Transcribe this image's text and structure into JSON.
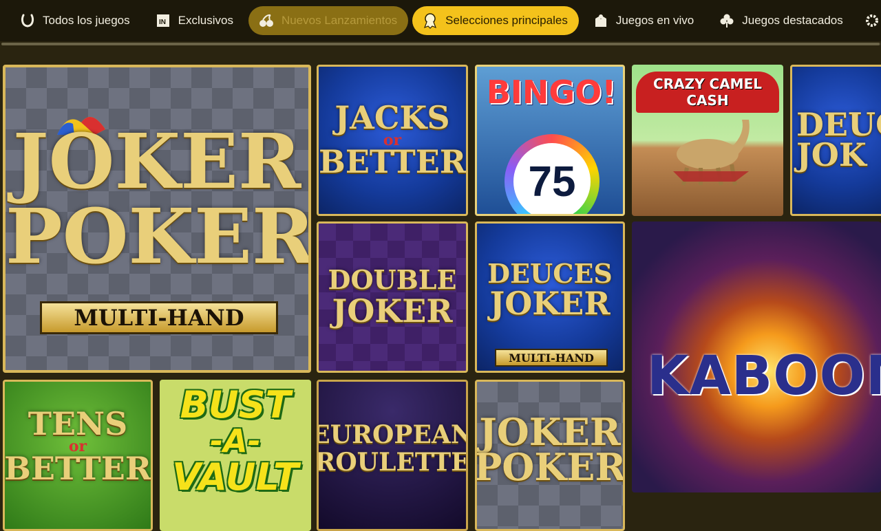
{
  "nav": {
    "tabs": [
      {
        "label": "Todos los juegos",
        "icon": "horseshoe-icon",
        "state": "normal"
      },
      {
        "label": "Exclusivos",
        "icon": "exclusive-badge-icon",
        "state": "normal"
      },
      {
        "label": "Nuevos Lanzamientos",
        "icon": "cherries-icon",
        "state": "dimmed"
      },
      {
        "label": "Selecciones principales",
        "icon": "award-ribbon-icon",
        "state": "active"
      },
      {
        "label": "Juegos en vivo",
        "icon": "dealer-icon",
        "state": "normal"
      },
      {
        "label": "Juegos destacados",
        "icon": "clover-icon",
        "state": "normal"
      }
    ]
  },
  "games": {
    "joker_poker_mh": {
      "line1": "JOKER",
      "line2": "POKER",
      "banner": "MULTI-HAND"
    },
    "jacks_or_better": {
      "line1": "JACKS",
      "mid": "or",
      "line2": "BETTER"
    },
    "bingo": {
      "title": "BINGO!",
      "ball": "75"
    },
    "crazy_camel": {
      "title": "CRAZY CAMEL CASH"
    },
    "deuces_joker_partial": {
      "line1": "DEUC",
      "line2": "JOK"
    },
    "double_joker": {
      "line1": "DOUBLE",
      "line2": "JOKER"
    },
    "deuces_joker_mh": {
      "line1": "DEUCES",
      "line2": "JOKER",
      "banner": "MULTI-HAND"
    },
    "kaboom": {
      "title": "KABOOM"
    },
    "tens_or_better": {
      "line1": "TENS",
      "mid": "or",
      "line2": "BETTER"
    },
    "bust_a_vault": {
      "line1": "BUST",
      "line2": "-A-",
      "line3": "VAULT"
    },
    "european_roulette": {
      "line1": "EUROPEAN",
      "line2": "ROULETTE"
    },
    "joker_poker": {
      "line1": "JOKER",
      "line2": "POKER"
    }
  },
  "colors": {
    "accent": "#f4c21b",
    "background": "#2a2410",
    "navbar": "#1c180a",
    "dimmed_tab": "#8a6f14"
  }
}
